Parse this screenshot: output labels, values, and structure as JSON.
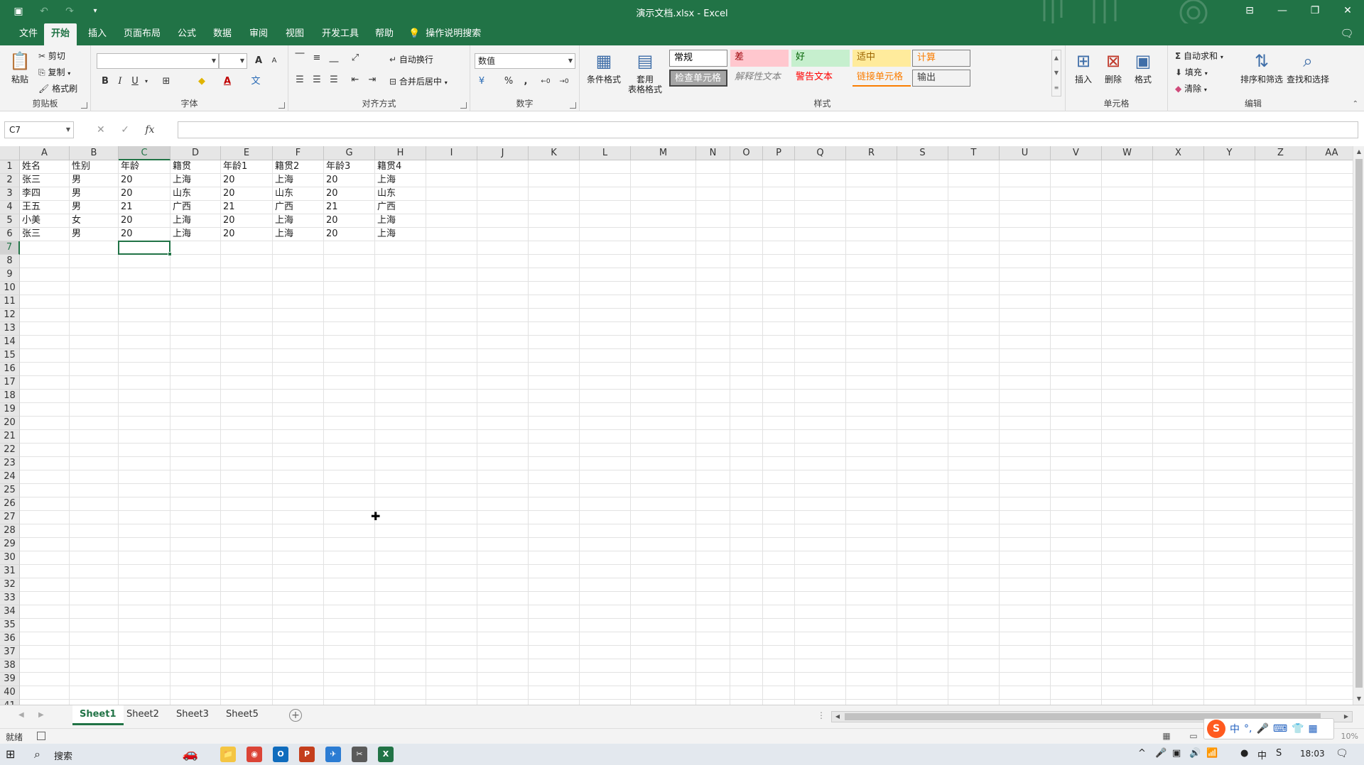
{
  "window": {
    "title": "演示文档.xlsx  -  Excel",
    "qat_icons": [
      "save-icon",
      "undo-icon",
      "redo-icon",
      "customize-icon"
    ],
    "controls": [
      "ribbon-display-icon",
      "minimize-icon",
      "restore-icon",
      "close-icon"
    ]
  },
  "ribbon_tabs": [
    "文件",
    "开始",
    "插入",
    "页面布局",
    "公式",
    "数据",
    "审阅",
    "视图",
    "开发工具",
    "帮助"
  ],
  "active_tab": "开始",
  "tell_me": "操作说明搜索",
  "clipboard": {
    "paste": "粘贴",
    "cut": "剪切",
    "copy": "复制",
    "format_painter": "格式刷",
    "label": "剪贴板"
  },
  "font": {
    "label": "字体",
    "name": "",
    "size": "",
    "bold": "B",
    "italic": "I",
    "underline": "U",
    "grow": "A",
    "shrink": "A",
    "font_color_glyph": "A",
    "phonetic_glyph": "文"
  },
  "alignment": {
    "label": "对齐方式",
    "wrap": "自动换行",
    "merge": "合并后居中"
  },
  "number": {
    "label": "数字",
    "format": "数值",
    "percent": "%",
    "comma": ",",
    "inc_decimal": "←0",
    "dec_decimal": "→0"
  },
  "styles": {
    "label": "样式",
    "conditional": "条件格式",
    "table_format_1": "套用",
    "table_format_2": "表格格式",
    "gallery": [
      {
        "text": "常规",
        "bg": "#ffffff",
        "fg": "#000000"
      },
      {
        "text": "差",
        "bg": "#ffc7ce",
        "fg": "#9c0006"
      },
      {
        "text": "好",
        "bg": "#c6efce",
        "fg": "#006100"
      },
      {
        "text": "适中",
        "bg": "#ffeb9c",
        "fg": "#9c6500"
      },
      {
        "text": "计算",
        "bg": "#f2f2f2",
        "fg": "#fa7d00"
      },
      {
        "text": "检查单元格",
        "bg": "#a5a5a5",
        "fg": "#ffffff"
      },
      {
        "text": "解释性文本",
        "bg": "#f3f3f3",
        "fg": "#7f7f7f"
      },
      {
        "text": "警告文本",
        "bg": "#f3f3f3",
        "fg": "#ff0000"
      },
      {
        "text": "链接单元格",
        "bg": "#f3f3f3",
        "fg": "#fa7d00"
      },
      {
        "text": "输出",
        "bg": "#f2f2f2",
        "fg": "#3f3f3f"
      }
    ]
  },
  "cells_group": {
    "label": "单元格",
    "insert": "插入",
    "delete": "删除",
    "format": "格式"
  },
  "editing": {
    "label": "编辑",
    "autosum": "自动求和",
    "fill": "填充",
    "clear": "清除",
    "sort": "排序和筛选",
    "find": "查找和选择"
  },
  "formula_bar": {
    "name_box": "C7",
    "fx": "fx",
    "value": ""
  },
  "sheet": {
    "columns": [
      "A",
      "B",
      "C",
      "D",
      "E",
      "F",
      "G",
      "H",
      "I",
      "J",
      "K",
      "L",
      "M",
      "N",
      "O",
      "P",
      "Q",
      "R",
      "S",
      "T",
      "U",
      "V",
      "W",
      "X",
      "Y",
      "Z",
      "AA"
    ],
    "selected_column": "C",
    "selected_row": 7,
    "row_count": 41,
    "data": [
      [
        "姓名",
        "性别",
        "年龄",
        "籍贯",
        "年龄1",
        "籍贯2",
        "年龄3",
        "籍贯4"
      ],
      [
        "张三",
        "男",
        "20",
        "上海",
        "20",
        "上海",
        "20",
        "上海"
      ],
      [
        "李四",
        "男",
        "20",
        "山东",
        "20",
        "山东",
        "20",
        "山东"
      ],
      [
        "王五",
        "男",
        "21",
        "广西",
        "21",
        "广西",
        "21",
        "广西"
      ],
      [
        "小美",
        "女",
        "20",
        "上海",
        "20",
        "上海",
        "20",
        "上海"
      ],
      [
        "张三",
        "男",
        "20",
        "上海",
        "20",
        "上海",
        "20",
        "上海"
      ]
    ]
  },
  "sheet_tabs": [
    "Sheet1",
    "Sheet2",
    "Sheet3",
    "Sheet5"
  ],
  "active_sheet": "Sheet1",
  "status": {
    "text": "就绪",
    "zoom": "10%"
  },
  "ime": [
    "中",
    "°,",
    "🎤",
    "⌨",
    "👕",
    "▦"
  ],
  "taskbar": {
    "search": "搜索",
    "apps": [
      {
        "name": "file-explorer",
        "glyph": "📁",
        "color": "#f4c542"
      },
      {
        "name": "chrome",
        "glyph": "◉",
        "color": "#db4437"
      },
      {
        "name": "outlook",
        "glyph": "O",
        "color": "#0f6cbd"
      },
      {
        "name": "powerpoint",
        "glyph": "P",
        "color": "#c43e1c"
      },
      {
        "name": "app-blue",
        "glyph": "✈",
        "color": "#2b7cd3"
      },
      {
        "name": "app-tool",
        "glyph": "✂",
        "color": "#5a5a5a"
      },
      {
        "name": "excel",
        "glyph": "X",
        "color": "#217346"
      }
    ],
    "tray": [
      "^",
      "🎤",
      "▣",
      "🔊",
      "📶",
      "●",
      "中",
      "S"
    ],
    "clock": "18:03"
  }
}
